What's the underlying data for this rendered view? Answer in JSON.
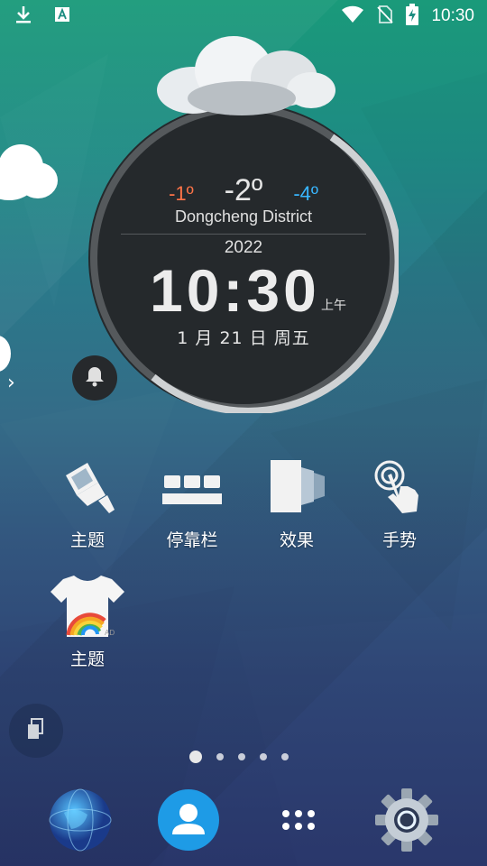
{
  "status_bar": {
    "time": "10:30",
    "icons": [
      "download-icon",
      "font-icon",
      "wifi-icon",
      "no-sim-icon",
      "battery-charging-icon"
    ]
  },
  "weather_clock": {
    "temp_high": "-1º",
    "temp_current": "-2º",
    "temp_low": "-4º",
    "district": "Dongcheng District",
    "year": "2022",
    "time": "10:30",
    "am_pm": "上午",
    "date": "1 月 21 日 周五"
  },
  "apps": [
    {
      "label": "主题",
      "icon": "theme-brush-icon"
    },
    {
      "label": "停靠栏",
      "icon": "dock-icon"
    },
    {
      "label": "效果",
      "icon": "effects-icon"
    },
    {
      "label": "手势",
      "icon": "gesture-icon"
    },
    {
      "label": "主题",
      "icon": "theme-shirt-icon"
    }
  ],
  "pager": {
    "pages": 5,
    "active": 0
  },
  "dock": [
    "globe-icon",
    "contacts-icon",
    "app-drawer-icon",
    "settings-gear-icon"
  ],
  "colors": {
    "temp_high": "#ff7448",
    "temp_low": "#38b6ff",
    "contacts_blue": "#1e9be6"
  }
}
